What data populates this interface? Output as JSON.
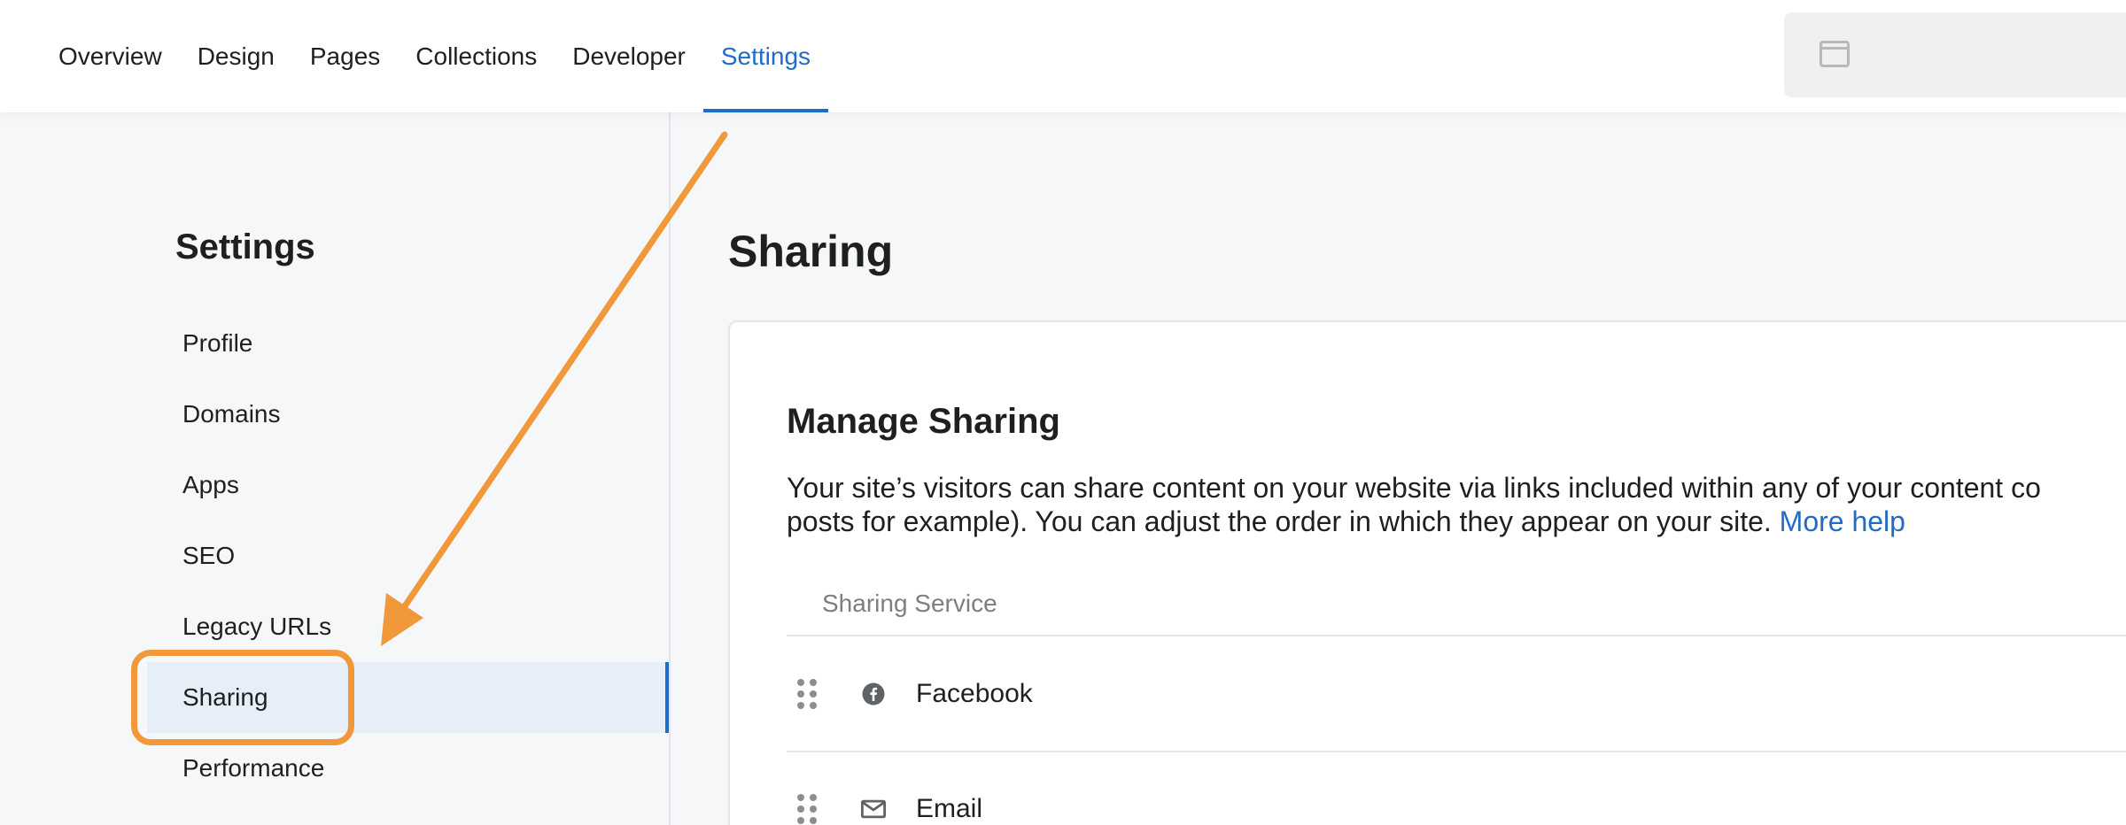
{
  "nav": {
    "tabs": [
      {
        "label": "Overview"
      },
      {
        "label": "Design"
      },
      {
        "label": "Pages"
      },
      {
        "label": "Collections"
      },
      {
        "label": "Developer"
      },
      {
        "label": "Settings",
        "active": true
      }
    ]
  },
  "sidebar": {
    "title": "Settings",
    "items": [
      {
        "label": "Profile"
      },
      {
        "label": "Domains"
      },
      {
        "label": "Apps"
      },
      {
        "label": "SEO"
      },
      {
        "label": "Legacy URLs"
      },
      {
        "label": "Sharing",
        "active": true
      },
      {
        "label": "Performance"
      }
    ]
  },
  "main": {
    "title": "Sharing",
    "card": {
      "title": "Manage Sharing",
      "desc_line1": "Your site’s visitors can share content on your website via links included within any of your content co",
      "desc_line2": "posts for example). You can adjust the order in which they appear on your site. ",
      "more_help": "More help",
      "column_header": "Sharing Service",
      "services": [
        {
          "name": "Facebook",
          "icon": "facebook-icon"
        },
        {
          "name": "Email",
          "icon": "email-icon"
        }
      ]
    }
  },
  "colors": {
    "accent": "#1f6bc9",
    "annotation": "#f0983a",
    "active_bg": "#e6eef7"
  }
}
